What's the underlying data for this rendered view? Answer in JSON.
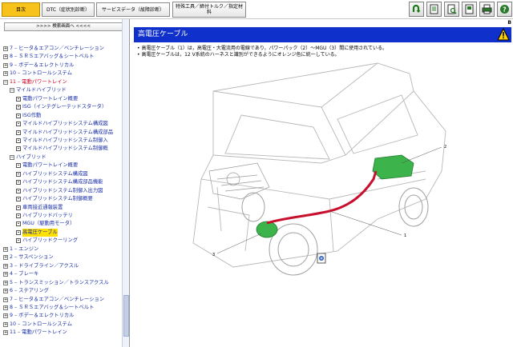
{
  "toolbar": {
    "tabs": [
      "目次",
      "DTC（症状別診断）",
      "サービスデータ（故障診断）",
      "特殊工具／締付トルク／指定材料"
    ],
    "buttons": [
      "back-icon",
      "page-icon",
      "search-doc-icon",
      "print-icon",
      "printer-icon",
      "help-icon"
    ]
  },
  "sidebar": {
    "search_label": ">>>> 検索画面へ <<<<",
    "tree": [
      {
        "t": "7 – ヒータ＆エアコン／ベンチレーション",
        "lvl": 0,
        "k": "plus",
        "c": "blue"
      },
      {
        "t": "8 – ＳＲＳエアバッグ＆シートベルト",
        "lvl": 0,
        "k": "plus",
        "c": "blue"
      },
      {
        "t": "9 – ボデー＆エレクトリカル",
        "lvl": 0,
        "k": "plus",
        "c": "blue"
      },
      {
        "t": "10 – コントロールシステム",
        "lvl": 0,
        "k": "plus",
        "c": "blue"
      },
      {
        "t": "11 – 電動パワートレイン",
        "lvl": 0,
        "k": "minus",
        "c": "red"
      },
      {
        "t": "マイルドハイブリッド",
        "lvl": 1,
        "k": "minus",
        "c": "blue"
      },
      {
        "t": "電動パワートレイン概要",
        "lvl": 2,
        "k": "leaf",
        "c": "blue"
      },
      {
        "t": "ISG（インテグレーテッドスタータ）",
        "lvl": 2,
        "k": "leaf",
        "c": "blue"
      },
      {
        "t": "ISG作動",
        "lvl": 2,
        "k": "leaf",
        "c": "blue"
      },
      {
        "t": "マイルドハイブリッドシステム構成図",
        "lvl": 2,
        "k": "leaf",
        "c": "blue"
      },
      {
        "t": "マイルドハイブリッドシステム構成部品",
        "lvl": 2,
        "k": "leaf",
        "c": "blue"
      },
      {
        "t": "マイルドハイブリッドシステム制御入",
        "lvl": 2,
        "k": "leaf",
        "c": "blue"
      },
      {
        "t": "マイルドハイブリッドシステム制御概",
        "lvl": 2,
        "k": "leaf",
        "c": "blue"
      },
      {
        "t": "ハイブリッド",
        "lvl": 1,
        "k": "minus",
        "c": "blue"
      },
      {
        "t": "電動パワートレイン概要",
        "lvl": 2,
        "k": "leaf",
        "c": "blue"
      },
      {
        "t": "ハイブリッドシステム構成図",
        "lvl": 2,
        "k": "leaf",
        "c": "blue"
      },
      {
        "t": "ハイブリッドシステム構成部品機能",
        "lvl": 2,
        "k": "leaf",
        "c": "blue"
      },
      {
        "t": "ハイブリッドシステム制御入出力図",
        "lvl": 2,
        "k": "leaf",
        "c": "blue"
      },
      {
        "t": "ハイブリッドシステム制御概要",
        "lvl": 2,
        "k": "leaf",
        "c": "blue"
      },
      {
        "t": "車両接近通報装置",
        "lvl": 2,
        "k": "leaf",
        "c": "blue"
      },
      {
        "t": "ハイブリッドバッテリ",
        "lvl": 2,
        "k": "leaf",
        "c": "blue"
      },
      {
        "t": "MGU（駆動用モータ）",
        "lvl": 2,
        "k": "leaf",
        "c": "blue"
      },
      {
        "t": "高電圧ケーブル",
        "lvl": 2,
        "k": "leaf",
        "c": "blue",
        "sel": true
      },
      {
        "t": "ハイブリッドクーリング",
        "lvl": 2,
        "k": "leaf",
        "c": "blue"
      },
      {
        "t": "1 – エンジン",
        "lvl": 0,
        "k": "plus",
        "c": "blue"
      },
      {
        "t": "2 – サスペンション",
        "lvl": 0,
        "k": "plus",
        "c": "blue"
      },
      {
        "t": "3 – ドライブライン／アクスル",
        "lvl": 0,
        "k": "plus",
        "c": "blue"
      },
      {
        "t": "4 – ブレーキ",
        "lvl": 0,
        "k": "plus",
        "c": "blue"
      },
      {
        "t": "5 – トランスミッション／トランスアクスル",
        "lvl": 0,
        "k": "plus",
        "c": "blue"
      },
      {
        "t": "6 – ステアリング",
        "lvl": 0,
        "k": "plus",
        "c": "blue"
      },
      {
        "t": "7 – ヒータ＆エアコン／ベンチレーション",
        "lvl": 0,
        "k": "plus",
        "c": "blue"
      },
      {
        "t": "8 – ＳＲＳエアバッグ＆シートベルト",
        "lvl": 0,
        "k": "plus",
        "c": "blue"
      },
      {
        "t": "9 – ボデー＆エレクトリカル",
        "lvl": 0,
        "k": "plus",
        "c": "blue"
      },
      {
        "t": "10 – コントロールシステム",
        "lvl": 0,
        "k": "plus",
        "c": "blue"
      },
      {
        "t": "11 – 電動パワートレイン",
        "lvl": 0,
        "k": "plus",
        "c": "blue"
      }
    ]
  },
  "content": {
    "corner_mark": "B",
    "title": "高電圧ケーブル",
    "bullets": [
      "高電圧ケーブル（1）は，高電圧・大電流用の電線であり，パワーパック（2）～MGU（3）間に使用されている。",
      "高電圧ケーブルは，12 V系統のハーネスと識別ができるようにオレンジ色に統一している。"
    ],
    "callouts": [
      "1",
      "2",
      "3"
    ],
    "colors": {
      "cable": "#c8102e",
      "component": "#3cb44b",
      "header": "#1030cc"
    }
  }
}
